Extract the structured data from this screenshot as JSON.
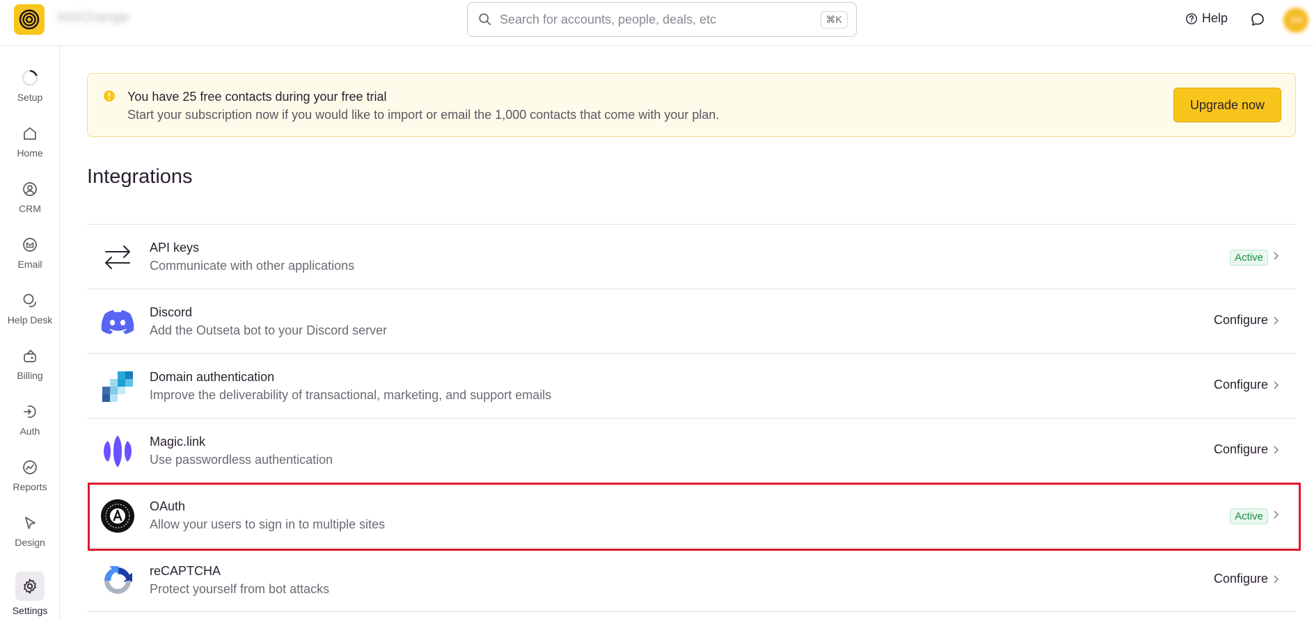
{
  "app": {
    "org_name": "InitiOrange",
    "search_placeholder": "Search for accounts, people, deals, etc",
    "search_shortcut": "⌘K",
    "help_label": "Help",
    "avatar_initials": "SM",
    "brand_color": "#f8c51c"
  },
  "sidebar": {
    "items": [
      {
        "label": "Setup",
        "icon": "progress-ring-icon"
      },
      {
        "label": "Home",
        "icon": "home-icon"
      },
      {
        "label": "CRM",
        "icon": "contact-icon"
      },
      {
        "label": "Email",
        "icon": "email-icon"
      },
      {
        "label": "Help Desk",
        "icon": "chat-bubbles-icon"
      },
      {
        "label": "Billing",
        "icon": "billing-icon"
      },
      {
        "label": "Auth",
        "icon": "auth-icon"
      },
      {
        "label": "Reports",
        "icon": "chart-icon"
      },
      {
        "label": "Design",
        "icon": "cursor-icon"
      },
      {
        "label": "Settings",
        "icon": "gear-icon",
        "active": true
      }
    ]
  },
  "banner": {
    "title": "You have 25 free contacts during your free trial",
    "text": "Start your subscription now if you would like to import or email the 1,000 contacts that come with your plan.",
    "button_label": "Upgrade now"
  },
  "page": {
    "title": "Integrations"
  },
  "integrations": [
    {
      "name": "API keys",
      "description": "Communicate with other applications",
      "status": "Active",
      "icon": "arrows-exchange-icon"
    },
    {
      "name": "Discord",
      "description": "Add the Outseta bot to your Discord server",
      "status": "Configure",
      "icon": "discord-icon"
    },
    {
      "name": "Domain authentication",
      "description": "Improve the deliverability of transactional, marketing, and support emails",
      "status": "Configure",
      "icon": "domain-blocks-icon"
    },
    {
      "name": "Magic.link",
      "description": "Use passwordless authentication",
      "status": "Configure",
      "icon": "magic-link-icon"
    },
    {
      "name": "OAuth",
      "description": "Allow your users to sign in to multiple sites",
      "status": "Active",
      "icon": "oauth-icon"
    },
    {
      "name": "reCAPTCHA",
      "description": "Protect yourself from bot attacks",
      "status": "Configure",
      "icon": "recaptcha-icon"
    }
  ]
}
